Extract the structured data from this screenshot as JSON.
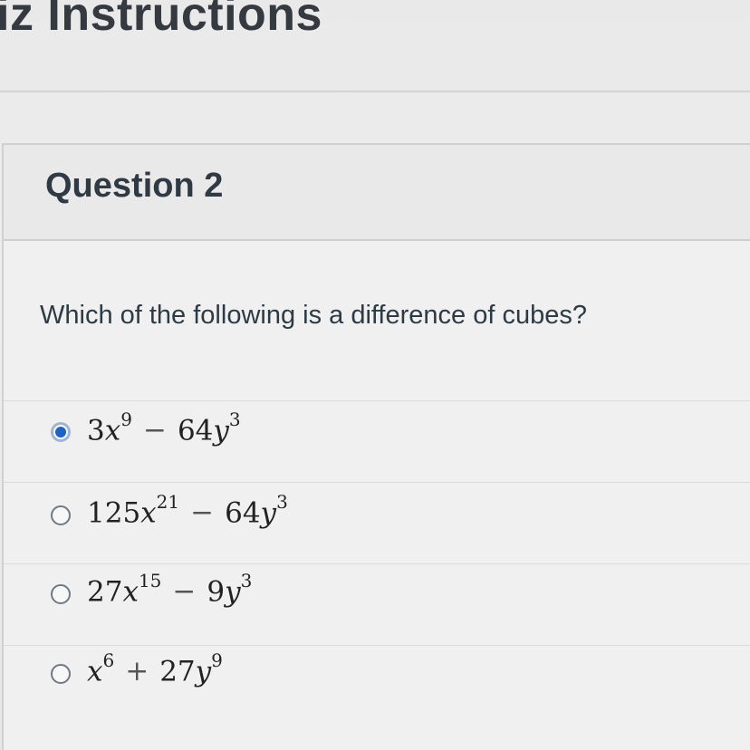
{
  "header": {
    "title": "iz Instructions"
  },
  "question": {
    "title": "Question 2",
    "prompt": "Which of the following is a difference of cubes?",
    "answers": [
      {
        "selected": true,
        "coef1": "3",
        "var1": "x",
        "exp1": "9",
        "op": "−",
        "coef2": "64",
        "var2": "y",
        "exp2": "3"
      },
      {
        "selected": false,
        "coef1": "125",
        "var1": "x",
        "exp1": "21",
        "op": "−",
        "coef2": "64",
        "var2": "y",
        "exp2": "3"
      },
      {
        "selected": false,
        "coef1": "27",
        "var1": "x",
        "exp1": "15",
        "op": "−",
        "coef2": "9",
        "var2": "y",
        "exp2": "3"
      },
      {
        "selected": false,
        "coef1": "",
        "var1": "x",
        "exp1": "6",
        "op": "+",
        "coef2": "27",
        "var2": "y",
        "exp2": "9"
      }
    ]
  },
  "colors": {
    "selected_radio": "#1c62c9",
    "text": "#2d3b45"
  }
}
